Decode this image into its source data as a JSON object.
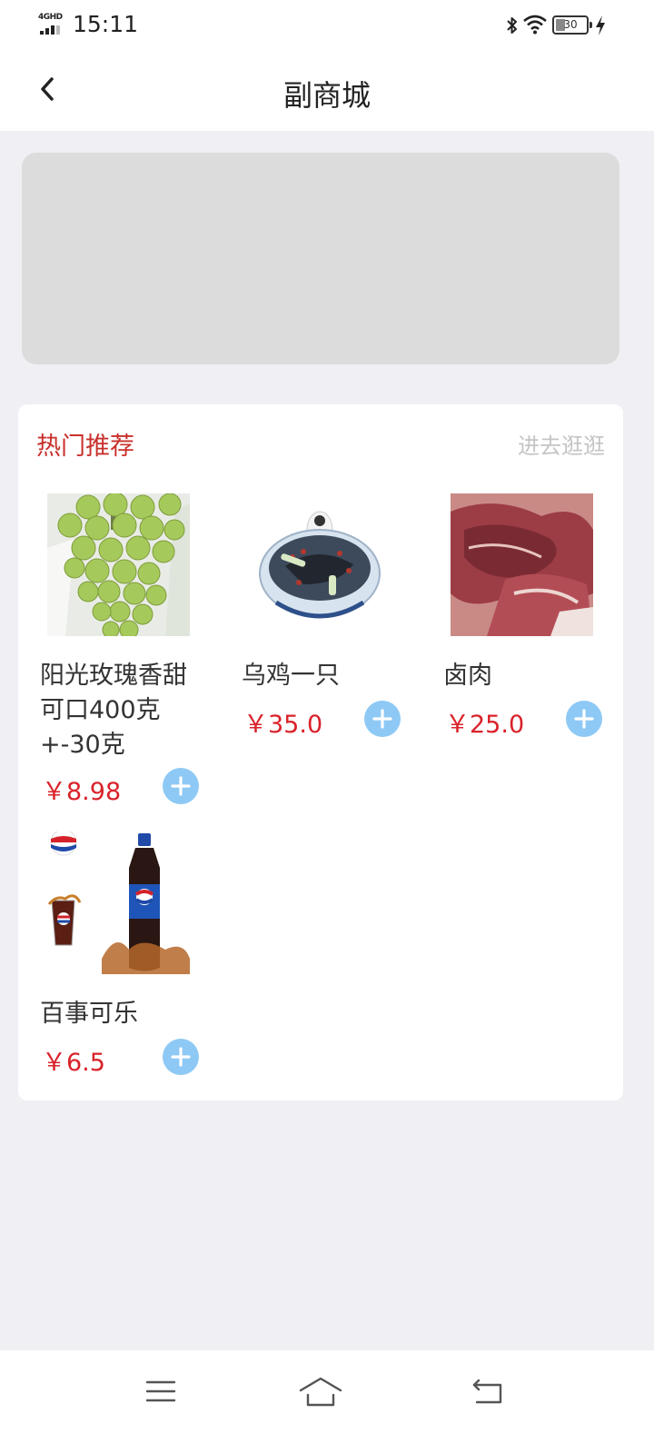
{
  "status_bar": {
    "network": "4GHD",
    "time": "15:11",
    "battery": "30"
  },
  "header": {
    "title": "副商城"
  },
  "hot_section": {
    "title": "热门推荐",
    "more_label": "进去逛逛"
  },
  "products": [
    {
      "name": "阳光玫瑰香甜可口400克+-30克",
      "price": "￥8.98",
      "image": "green-grapes"
    },
    {
      "name": "乌鸡一只",
      "price": "￥35.0",
      "image": "black-chicken-soup"
    },
    {
      "name": "卤肉",
      "price": "￥25.0",
      "image": "braised-meat"
    },
    {
      "name": "百事可乐",
      "price": "￥6.5",
      "image": "pepsi-bottle"
    }
  ],
  "icons": {
    "back": "chevron-left-icon",
    "add": "plus-circle-icon",
    "menu": "menu-icon",
    "home": "home-icon",
    "return": "return-icon"
  },
  "colors": {
    "accent_red": "#c8302b",
    "price_red": "#d9222a",
    "add_button": "#8ec9f5",
    "banner_placeholder": "#dcdcdc",
    "page_bg": "#efeff4"
  }
}
